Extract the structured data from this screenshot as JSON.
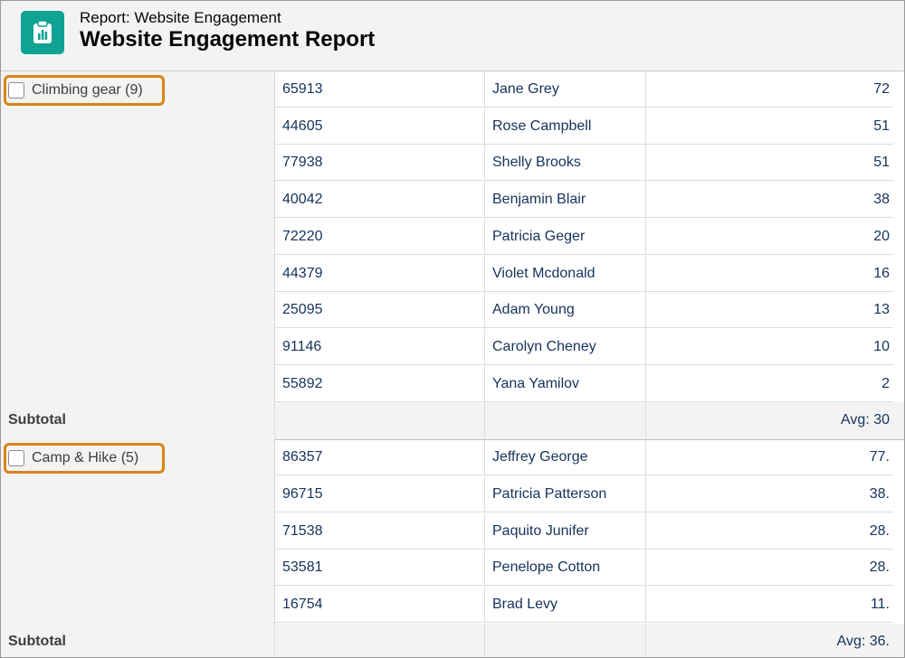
{
  "header": {
    "subtitle": "Report: Website Engagement",
    "title": "Website Engagement Report",
    "icon": "report-icon",
    "icon_color": "#0ea393"
  },
  "colors": {
    "highlight": "#d8841a",
    "text": "#16325c"
  },
  "groups": [
    {
      "label": "Climbing gear (9)",
      "rows": [
        {
          "id": "65913",
          "name": "Jane Grey",
          "value": "72"
        },
        {
          "id": "44605",
          "name": "Rose Campbell",
          "value": "51"
        },
        {
          "id": "77938",
          "name": "Shelly Brooks",
          "value": "51"
        },
        {
          "id": "40042",
          "name": "Benjamin Blair",
          "value": "38"
        },
        {
          "id": "72220",
          "name": "Patricia Geger",
          "value": "20"
        },
        {
          "id": "44379",
          "name": "Violet Mcdonald",
          "value": "16"
        },
        {
          "id": "25095",
          "name": "Adam Young",
          "value": "13"
        },
        {
          "id": "91146",
          "name": "Carolyn Cheney",
          "value": "10"
        },
        {
          "id": "55892",
          "name": "Yana Yamilov",
          "value": "2"
        }
      ],
      "subtotal_label": "Subtotal",
      "subtotal_value": "Avg: 30"
    },
    {
      "label": "Camp & Hike (5)",
      "rows": [
        {
          "id": "86357",
          "name": "Jeffrey George",
          "value": "77."
        },
        {
          "id": "96715",
          "name": "Patricia Patterson",
          "value": "38."
        },
        {
          "id": "71538",
          "name": "Paquito Junifer",
          "value": "28."
        },
        {
          "id": "53581",
          "name": "Penelope Cotton",
          "value": "28."
        },
        {
          "id": "16754",
          "name": "Brad Levy",
          "value": "11."
        }
      ],
      "subtotal_label": "Subtotal",
      "subtotal_value": "Avg: 36."
    }
  ]
}
